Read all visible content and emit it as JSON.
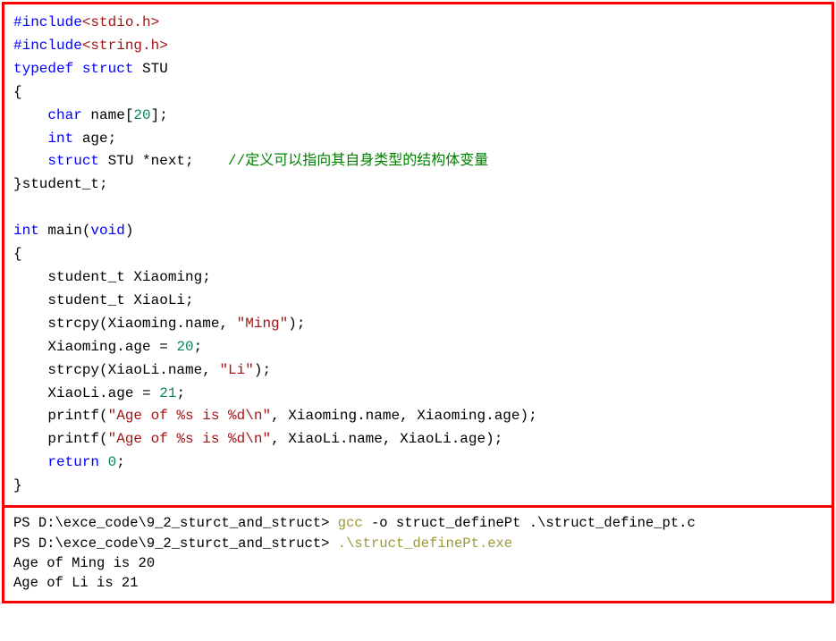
{
  "code": {
    "l1_a": "#include",
    "l1_b": "<stdio.h>",
    "l2_a": "#include",
    "l2_b": "<string.h>",
    "l3_a": "typedef",
    "l3_b": " struct",
    "l3_c": " STU",
    "l4": "{",
    "l5_a": "    ",
    "l5_b": "char",
    "l5_c": " name[",
    "l5_d": "20",
    "l5_e": "];",
    "l6_a": "    ",
    "l6_b": "int",
    "l6_c": " age;",
    "l7_a": "    ",
    "l7_b": "struct",
    "l7_c": " STU *next;    ",
    "l7_d": "//定义可以指向其自身类型的结构体变量",
    "l8": "}student_t;",
    "l9": "",
    "l10_a": "int",
    "l10_b": " main(",
    "l10_c": "void",
    "l10_d": ")",
    "l11": "{",
    "l12": "    student_t Xiaoming;",
    "l13": "    student_t XiaoLi;",
    "l14_a": "    strcpy(Xiaoming.name, ",
    "l14_b": "\"Ming\"",
    "l14_c": ");",
    "l15_a": "    Xiaoming.age = ",
    "l15_b": "20",
    "l15_c": ";",
    "l16_a": "    strcpy(XiaoLi.name, ",
    "l16_b": "\"Li\"",
    "l16_c": ");",
    "l17_a": "    XiaoLi.age = ",
    "l17_b": "21",
    "l17_c": ";",
    "l18_a": "    printf(",
    "l18_b": "\"Age of %s is %d\\n\"",
    "l18_c": ", Xiaoming.name, Xiaoming.age);",
    "l19_a": "    printf(",
    "l19_b": "\"Age of %s is %d\\n\"",
    "l19_c": ", XiaoLi.name, XiaoLi.age);",
    "l20_a": "    ",
    "l20_b": "return",
    "l20_c": " ",
    "l20_d": "0",
    "l20_e": ";",
    "l21": "}"
  },
  "term": {
    "t1_a": "PS D:\\exce_code\\9_2_sturct_and_struct> ",
    "t1_b": "gcc ",
    "t1_c": "-o struct_definePt .\\struct_define_pt.c",
    "t2_a": "PS D:\\exce_code\\9_2_sturct_and_struct> ",
    "t2_b": ".\\struct_definePt.exe",
    "t3": "Age of Ming is 20",
    "t4": "Age of Li is 21"
  }
}
